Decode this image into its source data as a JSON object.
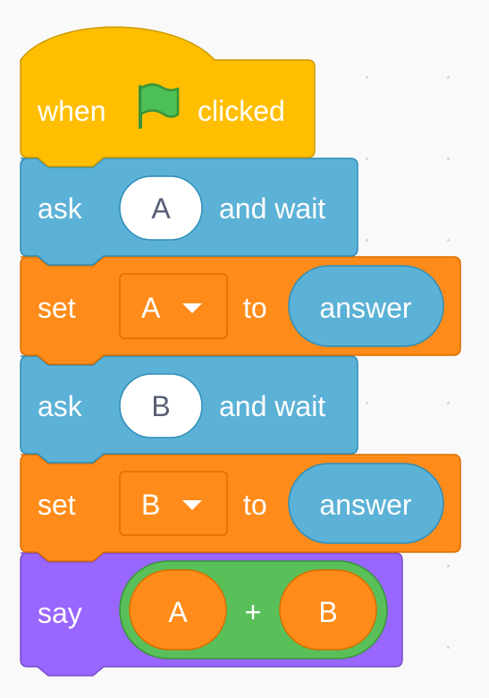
{
  "script": {
    "hat": {
      "before": "when",
      "icon": "green-flag-icon",
      "after": "clicked",
      "color": "#ffbf00",
      "stroke": "#cc9900"
    },
    "blocks": [
      {
        "type": "ask",
        "label": "ask",
        "input": "A",
        "suffix": "and wait",
        "color": "#5cb1d6",
        "stroke": "#2e8eb8"
      },
      {
        "type": "set",
        "label": "set",
        "variable": "A",
        "to_label": "to",
        "reporter": "answer",
        "color": "#ff8c1a",
        "stroke": "#db6e00"
      },
      {
        "type": "ask",
        "label": "ask",
        "input": "B",
        "suffix": "and wait",
        "color": "#5cb1d6",
        "stroke": "#2e8eb8"
      },
      {
        "type": "set",
        "label": "set",
        "variable": "B",
        "to_label": "to",
        "reporter": "answer",
        "color": "#ff8c1a",
        "stroke": "#db6e00"
      },
      {
        "type": "say",
        "label": "say",
        "operator": {
          "left": "A",
          "symbol": "+",
          "right": "B",
          "color": "#59c059",
          "stroke": "#389438"
        },
        "color": "#9966ff",
        "stroke": "#774dcb"
      }
    ]
  }
}
